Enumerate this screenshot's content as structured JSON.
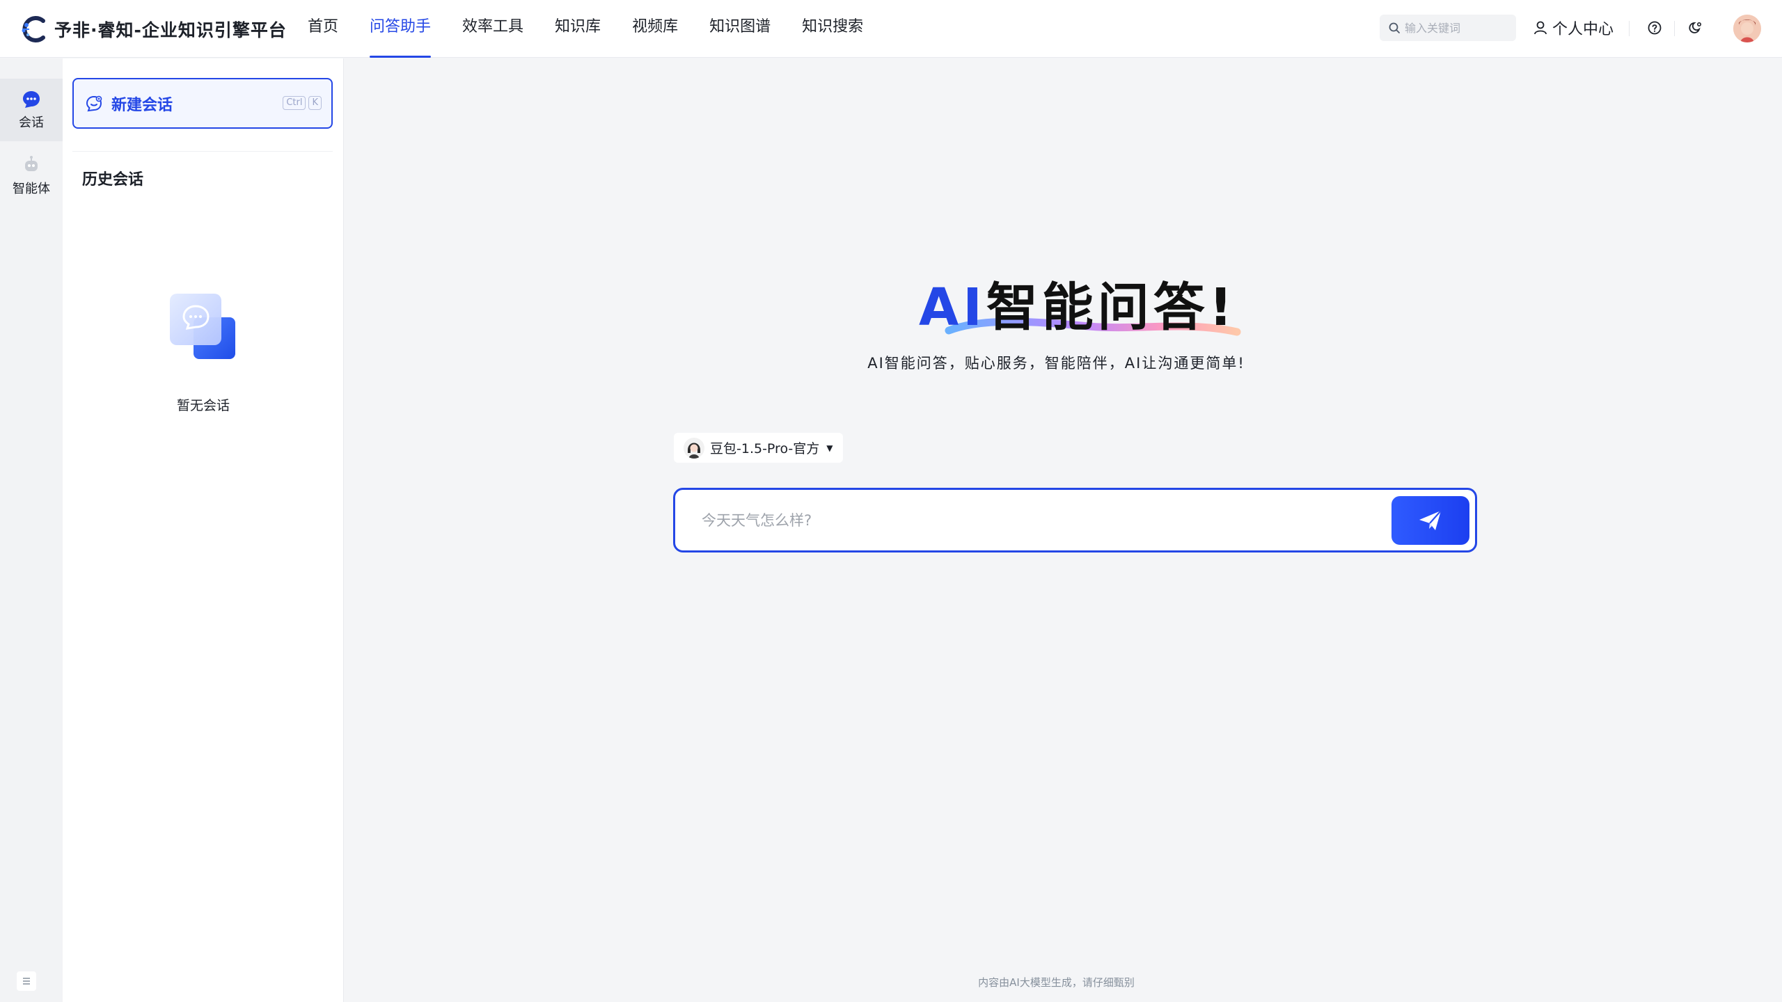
{
  "header": {
    "brand_title": "予非·睿知-企业知识引擎平台",
    "nav": [
      {
        "label": "首页",
        "active": false
      },
      {
        "label": "问答助手",
        "active": true
      },
      {
        "label": "效率工具",
        "active": false
      },
      {
        "label": "知识库",
        "active": false
      },
      {
        "label": "视频库",
        "active": false
      },
      {
        "label": "知识图谱",
        "active": false
      },
      {
        "label": "知识搜索",
        "active": false
      }
    ],
    "search_placeholder": "输入关键词",
    "user_center_label": "个人中心"
  },
  "rail": {
    "items": [
      {
        "label": "会话",
        "icon": "chat-bubble-icon",
        "active": true
      },
      {
        "label": "智能体",
        "icon": "robot-icon",
        "active": false
      }
    ]
  },
  "sidebar": {
    "new_chat_label": "新建会话",
    "shortcut_keys": [
      "Ctrl",
      "K"
    ],
    "history_title": "历史会话",
    "empty_text": "暂无会话"
  },
  "main": {
    "hero_ai": "AI",
    "hero_rest": "智能问答!",
    "subtitle": "AI智能问答，贴心服务，智能陪伴，AI让沟通更简单!",
    "model_name": "豆包-1.5-Pro-官方",
    "input_placeholder": "今天天气怎么样?",
    "disclaimer": "内容由AI大模型生成，请仔细甄别"
  },
  "colors": {
    "accent": "#2447e6",
    "background": "#f4f5f7"
  }
}
